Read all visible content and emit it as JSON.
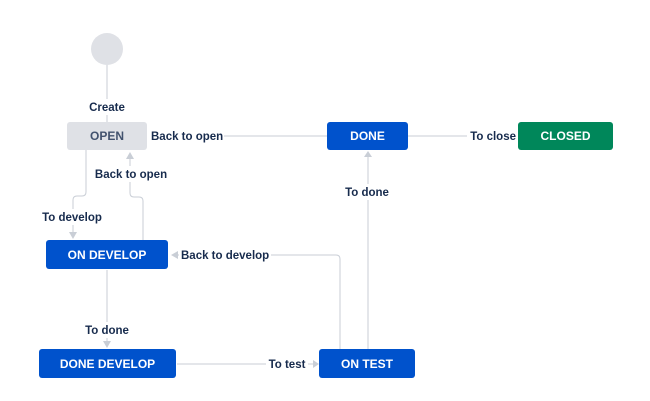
{
  "colors": {
    "start_node": "#dfe1e6",
    "status_todo_bg": "#dfe1e6",
    "status_todo_text": "#42526e",
    "status_inprogress_bg": "#0052cc",
    "status_done_bg": "#00875a",
    "status_light_text": "#ffffff",
    "edge": "#c9ced6",
    "transition_text": "#172b4d"
  },
  "statuses": {
    "open": "OPEN",
    "done": "DONE",
    "closed": "CLOSED",
    "on_develop": "ON DEVELOP",
    "done_develop": "DONE DEVELOP",
    "on_test": "ON TEST"
  },
  "transitions": {
    "create": "Create",
    "back_to_open_from_done": "Back to open",
    "to_close": "To close",
    "back_to_open_from_develop": "Back to open",
    "to_develop": "To develop",
    "to_done_from_test": "To done",
    "back_to_develop": "Back to develop",
    "to_done_from_develop": "To done",
    "to_test": "To test"
  }
}
